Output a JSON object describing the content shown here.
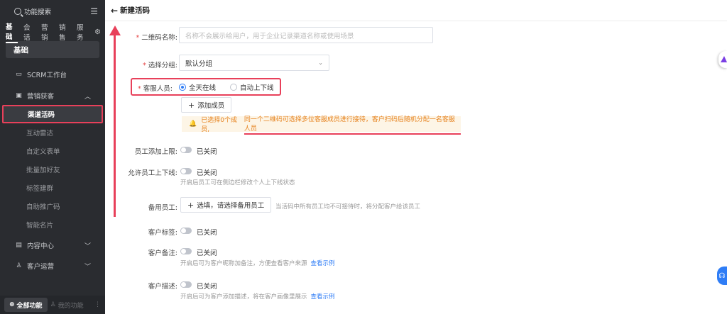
{
  "sidebar": {
    "search_label": "功能搜索",
    "tabs": [
      "基础",
      "会话",
      "营销",
      "销售",
      "服务"
    ],
    "section_title": "基础",
    "items": {
      "workbench": "SCRM工作台",
      "marketing": "营销获客",
      "content": "内容中心",
      "customer_ops": "客户运营"
    },
    "sub_items": [
      "渠道活码",
      "互动雷达",
      "自定义表单",
      "批量加好友",
      "标签建群",
      "自助推广码",
      "智能名片"
    ],
    "bottom": {
      "all_features": "全部功能",
      "my_features": "我的功能"
    }
  },
  "header": {
    "title": "新建活码"
  },
  "form": {
    "name_label": "二维码名称:",
    "name_placeholder": "名称不会展示给用户，用于企业记录渠道名称或使用场景",
    "group_label": "选择分组:",
    "group_value": "默认分组",
    "staff_label": "客服人员:",
    "staff_options": [
      "全天在线",
      "自动上下线"
    ],
    "add_member": "添加成员",
    "warning_prefix": "已选择0个成员,",
    "warning_text": "同一个二维码可选择多位客服成员进行接待，客户扫码后随机分配一名客服人员",
    "add_limit_label": "员工添加上限:",
    "add_limit_state": "已关闭",
    "allow_online_label": "允许员工上下线:",
    "allow_online_state": "已关闭",
    "allow_online_help": "开启后员工可在侧边栏修改个人上下线状态",
    "backup_label": "备用员工:",
    "backup_button": "选填，请选择备用员工",
    "backup_help": "当活码中所有员工均不可接待时，将分配客户给该员工",
    "tag_label": "客户标签:",
    "tag_state": "已关闭",
    "remark_label": "客户备注:",
    "remark_state": "已关闭",
    "remark_help": "开启后可为客户昵称加备注，方便查看客户来源",
    "remark_link": "查看示例",
    "desc_label": "客户描述:",
    "desc_state": "已关闭",
    "desc_help": "开启后可为客户添加描述，将在客户画像里展示",
    "desc_link": "查看示例"
  },
  "colors": {
    "accent": "#2f7df6",
    "highlight": "#e8405a",
    "sidebar_bg": "#2a2c30"
  }
}
